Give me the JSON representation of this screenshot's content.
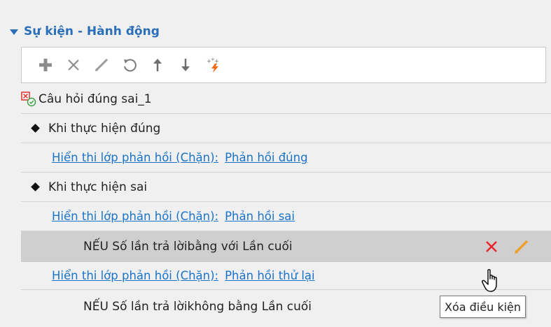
{
  "section": {
    "title": "Sự kiện - Hành động"
  },
  "toolbar": {
    "buttons": [
      "add-icon",
      "delete-icon",
      "edit-icon",
      "undo-icon",
      "move-up-icon",
      "move-down-icon",
      "magic-icon"
    ]
  },
  "tree": {
    "root_label": "Câu hỏi đúng sai_1",
    "correct_event": "Khi thực hiện đúng",
    "correct_action_prefix": "Hiển thi lớp phản hồi (Chặn):",
    "correct_action_target": "Phản hồi đúng",
    "wrong_event": "Khi thực hiện sai",
    "wrong_action_prefix": "Hiển thi lớp phản hồi (Chặn):",
    "wrong_action_target": "Phản hồi sai",
    "condition1": "NẾU Số lần trả lờibằng với Lần cuối",
    "retry_action_prefix": "Hiển thi lớp phản hồi (Chặn):",
    "retry_action_target": "Phản hồi thử lại",
    "condition2": "NẾU Số lần trả lờikhông bằng Lần cuối"
  },
  "tooltip": {
    "text": "Xóa điều kiện"
  },
  "colors": {
    "accent": "#2a6fb8",
    "link": "#1a73c9",
    "delete": "#e8262a",
    "edit": "#f0a030"
  }
}
